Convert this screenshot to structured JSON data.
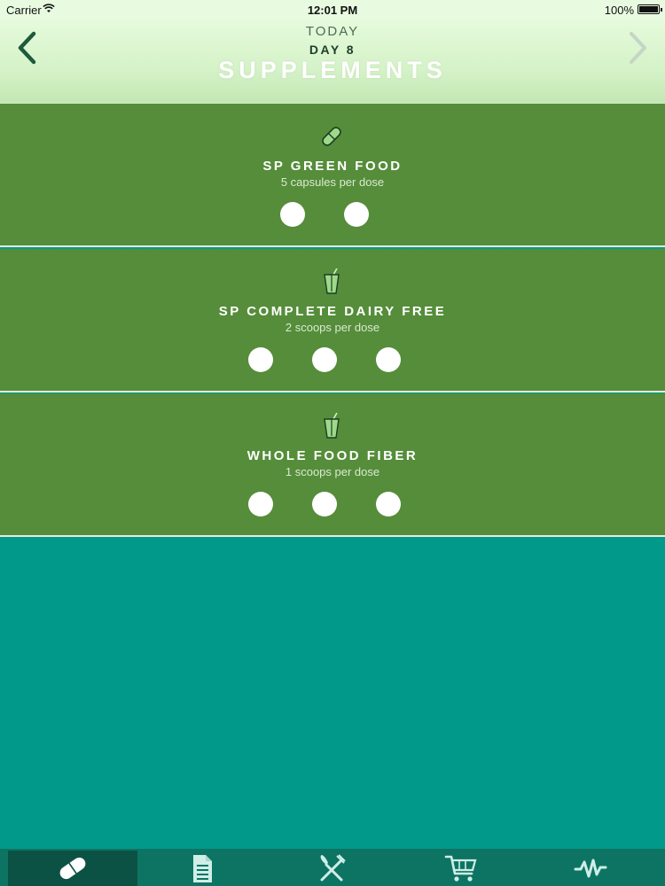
{
  "status_bar": {
    "carrier": "Carrier",
    "time": "12:01 PM",
    "battery": "100%"
  },
  "header": {
    "subtitle": "TODAY",
    "day": "DAY 8",
    "title": "SUPPLEMENTS",
    "back_icon": "chevron-left-icon",
    "forward_icon": "chevron-right-icon"
  },
  "supplements": [
    {
      "name": "SP GREEN FOOD",
      "dose": "5 capsules per dose",
      "icon": "capsule-icon",
      "doses_shown": 2
    },
    {
      "name": "SP COMPLETE DAIRY FREE",
      "dose": "2 scoops per dose",
      "icon": "drink-icon",
      "doses_shown": 3
    },
    {
      "name": "WHOLE FOOD FIBER",
      "dose": "1 scoops per dose",
      "icon": "drink-icon",
      "doses_shown": 3
    }
  ],
  "tabs": [
    {
      "icon": "capsule-icon",
      "active": true
    },
    {
      "icon": "document-icon",
      "active": false
    },
    {
      "icon": "fork-knife-icon",
      "active": false
    },
    {
      "icon": "cart-icon",
      "active": false
    },
    {
      "icon": "activity-icon",
      "active": false
    }
  ],
  "colors": {
    "header_bg": "#d5f2c8",
    "card_bg": "#558d3a",
    "page_bg": "#029d8c",
    "tab_bar_bg": "#0d7463",
    "tab_active_bg": "#0b5245"
  }
}
